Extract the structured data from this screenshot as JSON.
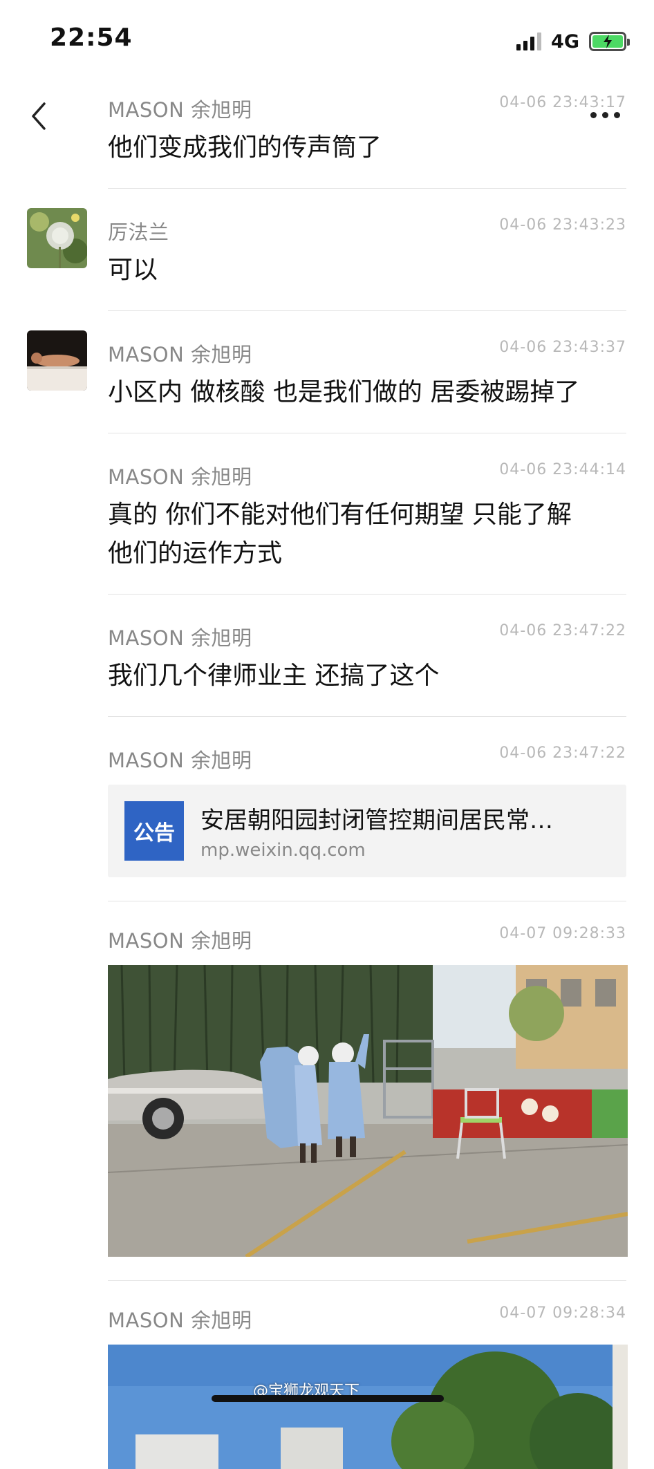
{
  "status_bar": {
    "time": "22:54",
    "network": "4G",
    "battery_color": "#4cd964"
  },
  "nav": {
    "back_icon": "chevron-left-icon",
    "more_icon": "ellipsis-icon"
  },
  "messages": [
    {
      "sender": "MASON 余旭明",
      "time": "04-06 23:43:17",
      "text": "他们变成我们的传声筒了"
    },
    {
      "sender": "厉法兰",
      "time": "04-06 23:43:23",
      "text": "可以"
    },
    {
      "sender": "MASON 余旭明",
      "time": "04-06 23:43:37",
      "text": "小区内 做核酸 也是我们做的 居委被踢掉了"
    },
    {
      "sender": "MASON 余旭明",
      "time": "04-06 23:44:14",
      "text_line1": "真的 你们不能对他们有任何期望 只能了解",
      "text_line2": "他们的运作方式"
    },
    {
      "sender": "MASON 余旭明",
      "time": "04-06 23:47:22",
      "text": "我们几个律师业主 还搞了这个"
    },
    {
      "sender": "MASON 余旭明",
      "time": "04-06 23:47:22",
      "link_badge": "公告",
      "link_title": "安居朝阳园封闭管控期间居民常…",
      "link_url": "mp.weixin.qq.com"
    },
    {
      "sender": "MASON 余旭明",
      "time": "04-07 09:28:33"
    },
    {
      "sender": "MASON 余旭明",
      "time": "04-07 09:28:34"
    }
  ],
  "watermark": "@宝狮龙观天下"
}
